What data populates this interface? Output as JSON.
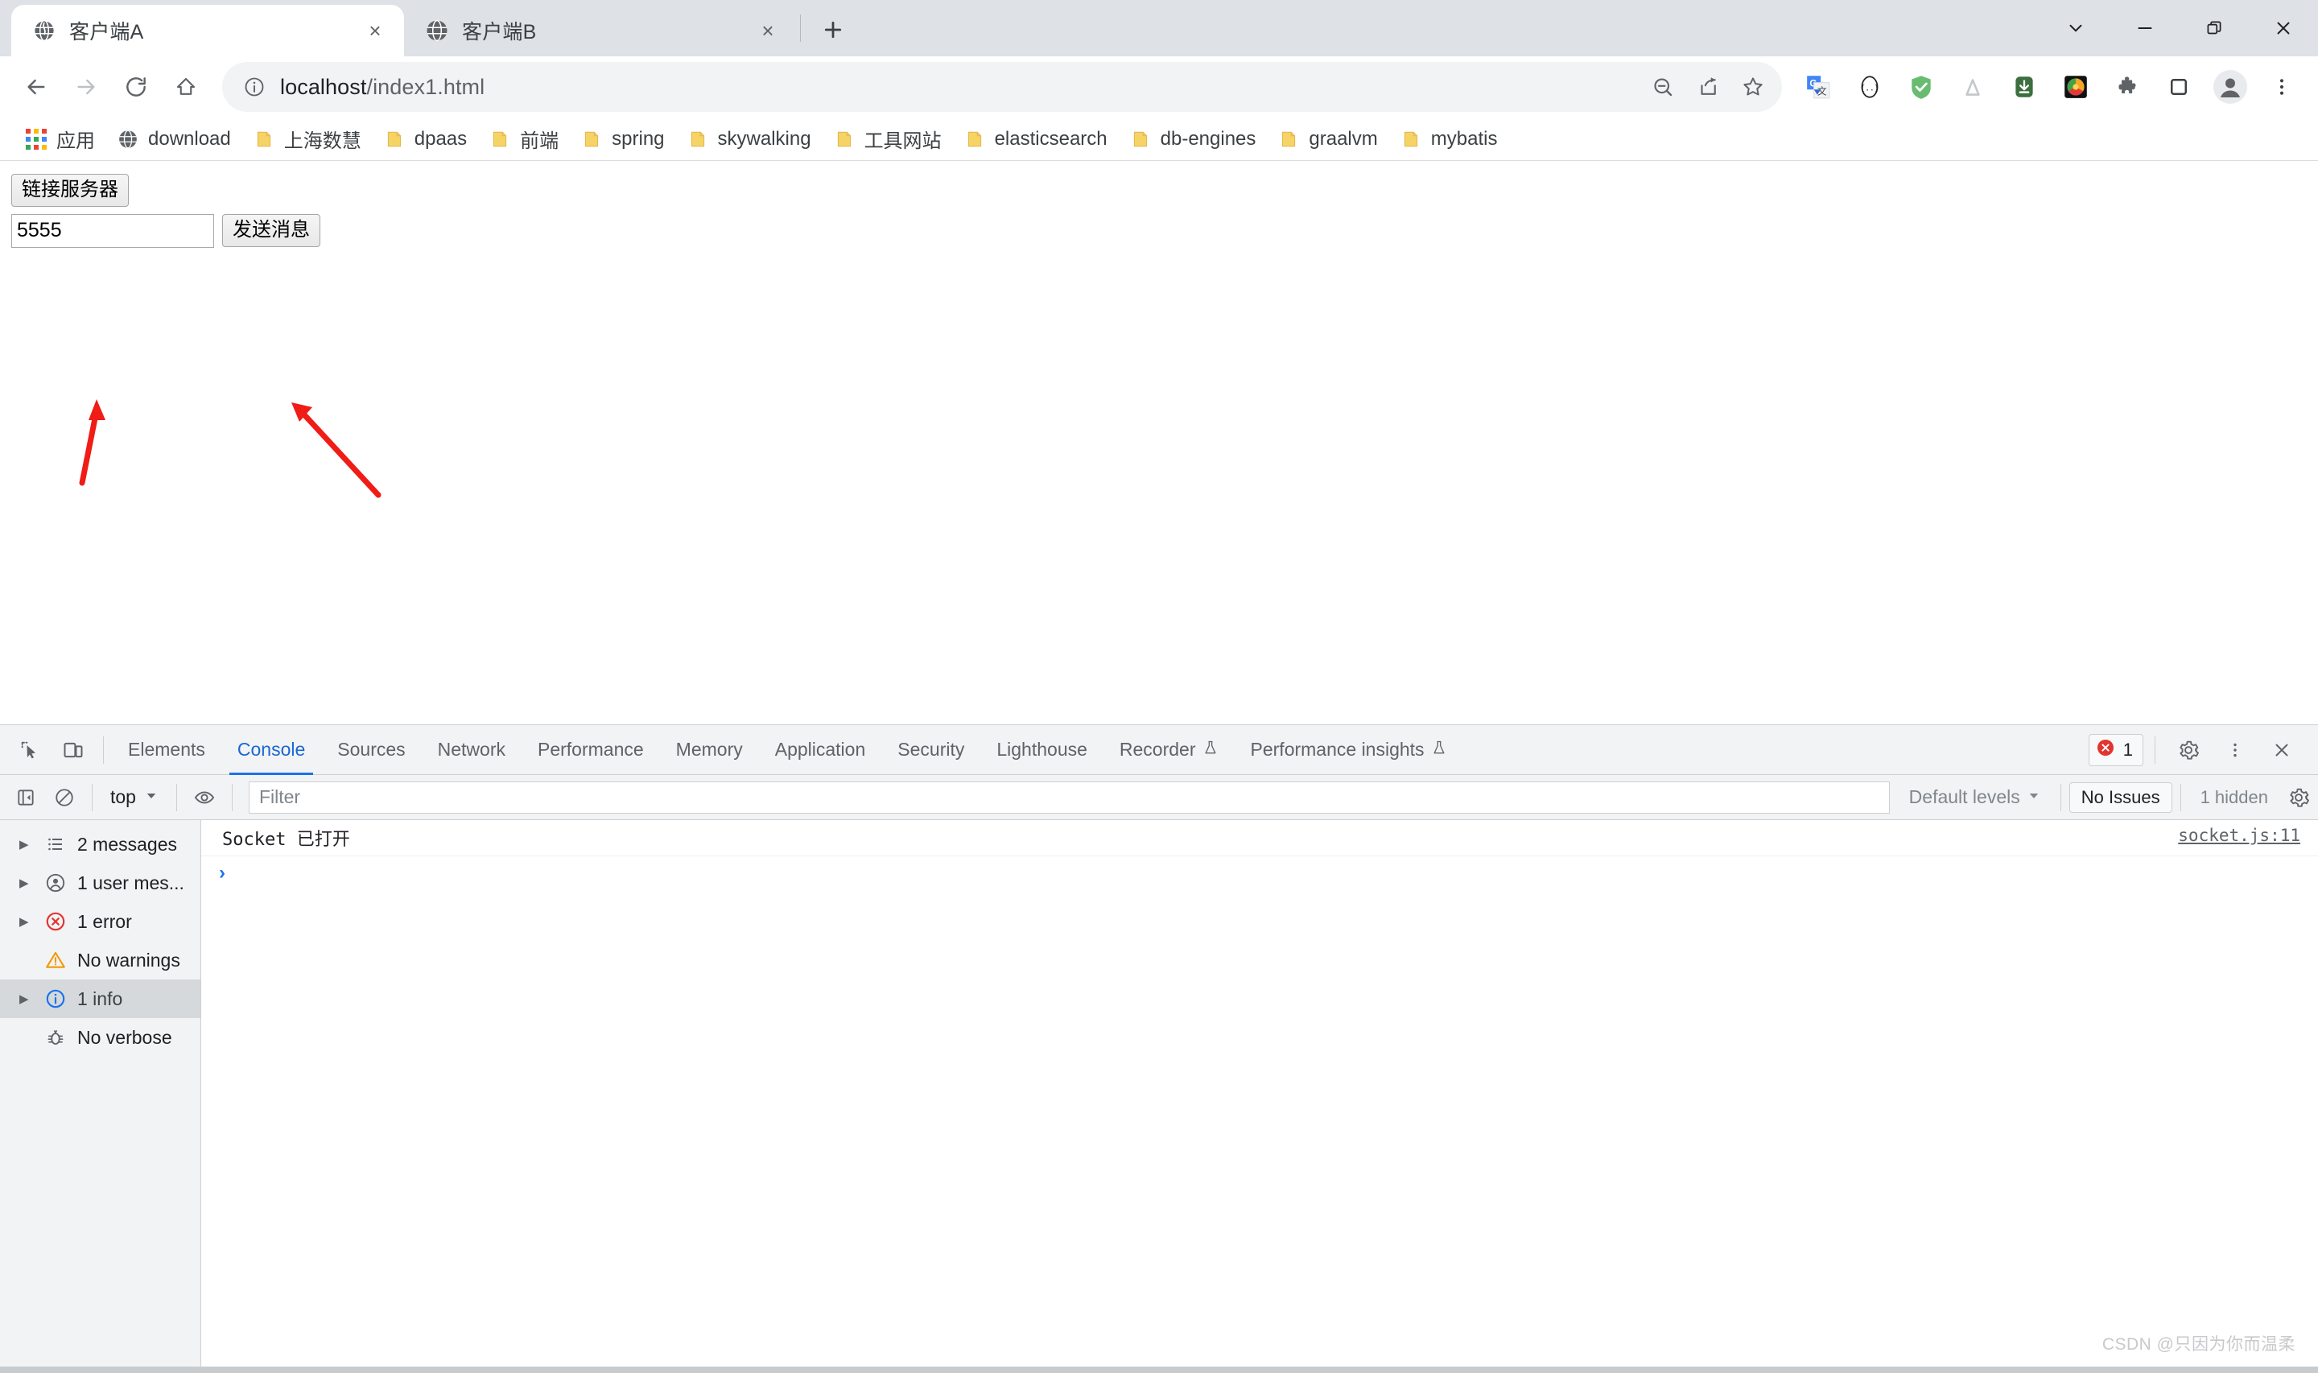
{
  "window": {
    "controls": [
      {
        "name": "tab-search",
        "glyph": "chevron-down"
      },
      {
        "name": "minimize",
        "glyph": "minimize"
      },
      {
        "name": "restore",
        "glyph": "restore"
      },
      {
        "name": "close",
        "glyph": "close"
      }
    ]
  },
  "tabs": [
    {
      "title": "客户端A",
      "favicon": "globe-icon",
      "active": true,
      "close_label": "×"
    },
    {
      "title": "客户端B",
      "favicon": "globe-icon",
      "active": false,
      "close_label": "×"
    }
  ],
  "newtab_label": "+",
  "toolbar": {
    "back": "back-arrow-icon",
    "forward": "forward-arrow-icon",
    "reload": "reload-icon",
    "home": "home-icon",
    "omnibox": {
      "info_icon": "info-circle-icon",
      "host": "localhost",
      "path": "/index1.html",
      "full_url": "localhost/index1.html",
      "actions": [
        "zoom-out-icon",
        "share-icon",
        "bookmark-star-icon"
      ]
    },
    "extensions": [
      "google-translate-icon",
      "json-formatter-icon",
      "adguard-shield-icon",
      "mountain-icon",
      "download-manager-icon",
      "colorful-extension-icon",
      "puzzle-extensions-icon",
      "side-panel-icon",
      "profile-avatar-icon",
      "kebab-menu-icon"
    ]
  },
  "bookmarks": [
    {
      "label": "应用",
      "icon": "apps-grid-icon"
    },
    {
      "label": "download",
      "icon": "globe-icon"
    },
    {
      "label": "上海数慧",
      "icon": "folder-icon"
    },
    {
      "label": "dpaas",
      "icon": "folder-icon"
    },
    {
      "label": "前端",
      "icon": "folder-icon"
    },
    {
      "label": "spring",
      "icon": "folder-icon"
    },
    {
      "label": "skywalking",
      "icon": "folder-icon"
    },
    {
      "label": "工具网站",
      "icon": "folder-icon"
    },
    {
      "label": "elasticsearch",
      "icon": "folder-icon"
    },
    {
      "label": "db-engines",
      "icon": "folder-icon"
    },
    {
      "label": "graalvm",
      "icon": "folder-icon"
    },
    {
      "label": "mybatis",
      "icon": "folder-icon"
    }
  ],
  "page": {
    "connect_button": "链接服务器",
    "message_input_value": "5555",
    "message_input_placeholder": "",
    "send_button": "发送消息",
    "annotation_color": "#f01c16",
    "annotations": [
      {
        "name": "arrow-to-message-input",
        "target": "message-input"
      },
      {
        "name": "arrow-to-send-button",
        "target": "send-button"
      }
    ]
  },
  "devtools": {
    "tools": [
      "inspect-element-icon",
      "device-toolbar-icon"
    ],
    "tabs": [
      {
        "label": "Elements",
        "active": false,
        "experimental": false
      },
      {
        "label": "Console",
        "active": true,
        "experimental": false
      },
      {
        "label": "Sources",
        "active": false,
        "experimental": false
      },
      {
        "label": "Network",
        "active": false,
        "experimental": false
      },
      {
        "label": "Performance",
        "active": false,
        "experimental": false
      },
      {
        "label": "Memory",
        "active": false,
        "experimental": false
      },
      {
        "label": "Application",
        "active": false,
        "experimental": false
      },
      {
        "label": "Security",
        "active": false,
        "experimental": false
      },
      {
        "label": "Lighthouse",
        "active": false,
        "experimental": false
      },
      {
        "label": "Recorder",
        "active": false,
        "experimental": true
      },
      {
        "label": "Performance insights",
        "active": false,
        "experimental": true
      }
    ],
    "error_count": "1",
    "settings_icon": "gear-icon",
    "more_icon": "kebab-menu-icon",
    "close_icon": "close-icon",
    "console_toolbar": {
      "sidebar_toggle": "sidebar-toggle-icon",
      "clear_console": "clear-console-icon",
      "context": "top",
      "live_expression": "eye-icon",
      "filter_placeholder": "Filter",
      "filter_value": "",
      "levels": "Default levels",
      "issues": "No Issues",
      "hidden": "1 hidden",
      "settings_icon": "gear-icon"
    },
    "sidebar": [
      {
        "label": "2 messages",
        "icon": "list-icon",
        "expandable": true,
        "selected": false
      },
      {
        "label": "1 user mes...",
        "icon": "user-message-icon",
        "expandable": true,
        "selected": false
      },
      {
        "label": "1 error",
        "icon": "error-circle-icon",
        "expandable": true,
        "selected": false
      },
      {
        "label": "No warnings",
        "icon": "warning-triangle-icon",
        "expandable": false,
        "selected": false
      },
      {
        "label": "1 info",
        "icon": "info-circle-icon",
        "expandable": true,
        "selected": true
      },
      {
        "label": "No verbose",
        "icon": "bug-icon",
        "expandable": false,
        "selected": false
      }
    ],
    "messages": [
      {
        "text": "Socket 已打开",
        "source": "socket.js:11"
      }
    ],
    "prompt_caret": "›"
  },
  "watermark": "CSDN @只因为你而温柔",
  "colors": {
    "accent": "#1a73e8",
    "tabstrip": "#dee1e6",
    "error": "#e3342f",
    "warning": "#f29900",
    "folder": "#f6d365",
    "annotation": "#f01c16"
  }
}
